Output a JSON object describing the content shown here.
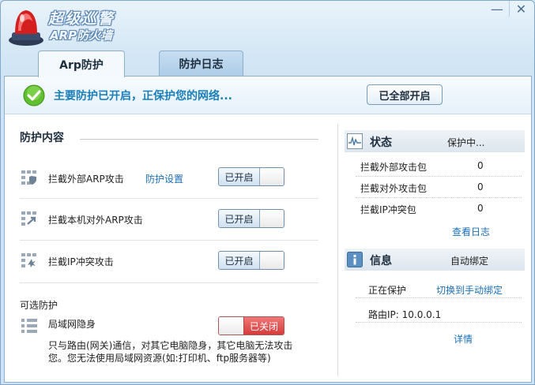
{
  "window": {
    "title_main": "超级巡警",
    "title_sub": "ARP防火墙",
    "minimize_glyph": "—",
    "close_glyph": "✕"
  },
  "tabs": [
    {
      "label": "Arp防护",
      "active": true
    },
    {
      "label": "防护日志",
      "active": false
    }
  ],
  "banner": {
    "text": "主要防护已开启，正保护您的网络...",
    "button": "已全部开启"
  },
  "protection": {
    "title": "防护内容",
    "items": [
      {
        "icon": "grid-shield-icon",
        "label": "拦截外部ARP攻击",
        "link": "防护设置",
        "state": "已开启"
      },
      {
        "icon": "grid-arrow-icon",
        "label": "拦截本机对外ARP攻击",
        "state": "已开启"
      },
      {
        "icon": "grid-burst-icon",
        "label": "拦截IP冲突攻击",
        "state": "已开启"
      }
    ]
  },
  "optional": {
    "title": "可选防护",
    "item": {
      "icon": "lan-icon",
      "label": "局域网隐身",
      "state": "已关闭"
    },
    "description": "只与路由(网关)通信，对其它电脑隐身，其它电脑无法攻击您。您无法使用局域网资源(如:打印机、ftp服务器等)"
  },
  "status": {
    "title": "状态",
    "value": "保护中...",
    "rows": [
      {
        "label": "拦截外部攻击包",
        "value": "0"
      },
      {
        "label": "拦截对外攻击包",
        "value": "0"
      },
      {
        "label": "拦截IP冲突包",
        "value": "0"
      }
    ],
    "link": "查看日志"
  },
  "info": {
    "title": "信息",
    "value": "自动绑定",
    "protecting_label": "正在保护",
    "switch_link": "切换到手动绑定",
    "router_label": "路由IP: 10.0.0.1",
    "detail_link": "详情"
  },
  "colors": {
    "accent": "#1a7fb8",
    "link": "#1c6fb8",
    "off_red": "#d53b3b"
  }
}
